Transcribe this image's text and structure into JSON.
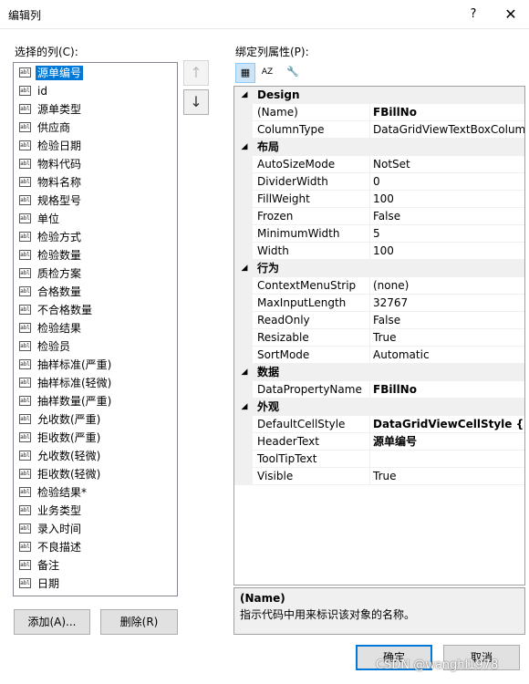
{
  "window": {
    "title": "编辑列",
    "help": "?",
    "close": "✕"
  },
  "left": {
    "label": "选择的列(C):",
    "columns": [
      "源单编号",
      "id",
      "源单类型",
      "供应商",
      "检验日期",
      "物料代码",
      "物料名称",
      "规格型号",
      "单位",
      "检验方式",
      "检验数量",
      "质检方案",
      "合格数量",
      "不合格数量",
      "检验结果",
      "检验员",
      "抽样标准(严重)",
      "抽样标准(轻微)",
      "抽样数量(严重)",
      "允收数(严重)",
      "拒收数(严重)",
      "允收数(轻微)",
      "拒收数(轻微)",
      "检验结果*",
      "业务类型",
      "录入时间",
      "不良描述",
      "备注",
      "日期"
    ],
    "selected_index": 0,
    "icon_text": "abl",
    "up_arrow": "↑",
    "down_arrow": "↓",
    "add_button": "添加(A)...",
    "remove_button": "删除(R)"
  },
  "right": {
    "label": "绑定列属性(P):",
    "toolbar": {
      "categorized": "▦",
      "alphabetical": "AZ",
      "property_pages": "🔧"
    },
    "categories": [
      {
        "name": "Design",
        "expander": "◢",
        "props": [
          {
            "name": "(Name)",
            "value": "FBillNo",
            "bold": true,
            "selected": true
          },
          {
            "name": "ColumnType",
            "value": "DataGridViewTextBoxColum",
            "bold": false
          }
        ]
      },
      {
        "name": "布局",
        "expander": "◢",
        "props": [
          {
            "name": "AutoSizeMode",
            "value": "NotSet",
            "bold": false
          },
          {
            "name": "DividerWidth",
            "value": "0",
            "bold": false
          },
          {
            "name": "FillWeight",
            "value": "100",
            "bold": false
          },
          {
            "name": "Frozen",
            "value": "False",
            "bold": false
          },
          {
            "name": "MinimumWidth",
            "value": "5",
            "bold": false
          },
          {
            "name": "Width",
            "value": "100",
            "bold": false
          }
        ]
      },
      {
        "name": "行为",
        "expander": "◢",
        "props": [
          {
            "name": "ContextMenuStrip",
            "value": "(none)",
            "bold": false
          },
          {
            "name": "MaxInputLength",
            "value": "32767",
            "bold": false
          },
          {
            "name": "ReadOnly",
            "value": "False",
            "bold": false
          },
          {
            "name": "Resizable",
            "value": "True",
            "bold": false
          },
          {
            "name": "SortMode",
            "value": "Automatic",
            "bold": false
          }
        ]
      },
      {
        "name": "数据",
        "expander": "◢",
        "props": [
          {
            "name": "DataPropertyName",
            "value": "FBillNo",
            "bold": true
          }
        ]
      },
      {
        "name": "外观",
        "expander": "◢",
        "props": [
          {
            "name": "DefaultCellStyle",
            "value": "DataGridViewCellStyle { Fo",
            "bold": true
          },
          {
            "name": "HeaderText",
            "value": "源单编号",
            "bold": true
          },
          {
            "name": "ToolTipText",
            "value": "",
            "bold": false
          },
          {
            "name": "Visible",
            "value": "True",
            "bold": false
          }
        ]
      }
    ],
    "description": {
      "title": "(Name)",
      "text": "指示代码中用来标识该对象的名称。"
    }
  },
  "footer": {
    "ok": "确定",
    "cancel": "取消",
    "watermark": "CSDN @wanghl1978"
  },
  "colors": {
    "accent": "#0078d7",
    "category_bg": "#f0f0f0"
  }
}
